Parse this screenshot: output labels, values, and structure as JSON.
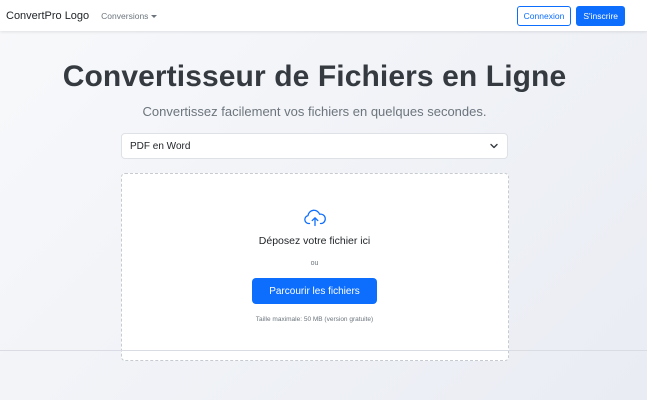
{
  "navbar": {
    "brand": "ConvertPro Logo",
    "conversions_label": "Conversions",
    "login_label": "Connexion",
    "signup_label": "S'inscrire"
  },
  "hero": {
    "title": "Convertisseur de Fichiers en Ligne",
    "subtitle": "Convertissez facilement vos fichiers en quelques secondes."
  },
  "converter": {
    "selected_conversion": "PDF en Word"
  },
  "dropzone": {
    "icon": "cloud-upload-icon",
    "drop_text": "Déposez votre fichier ici",
    "or_text": "ou",
    "browse_label": "Parcourir les fichiers",
    "size_limit": "Taille maximale: 50 MB (version gratuite)"
  },
  "colors": {
    "primary": "#0d6efd",
    "title": "#343a40",
    "muted": "#6c757d"
  }
}
